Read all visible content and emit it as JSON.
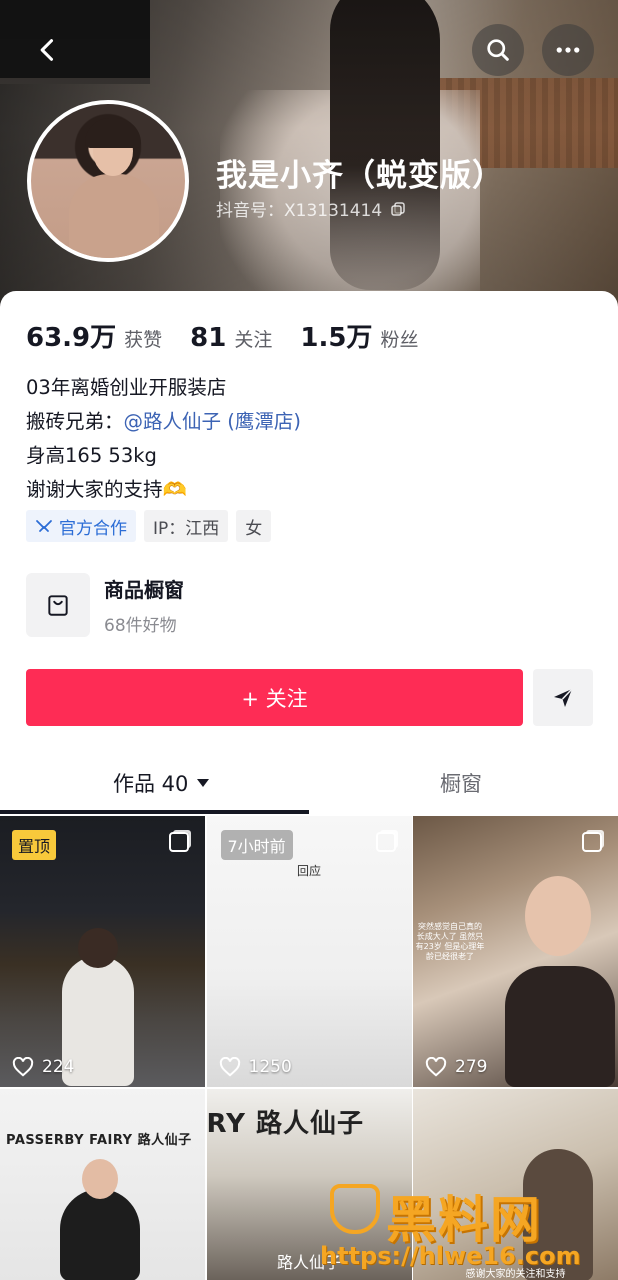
{
  "profile": {
    "nickname": "我是小齐（蜕变版）",
    "douyin_id": "抖音号：X13131414",
    "stats": [
      {
        "value": "63.9万",
        "label": "获赞"
      },
      {
        "value": "81",
        "label": "关注"
      },
      {
        "value": "1.5万",
        "label": "粉丝"
      }
    ],
    "bio": {
      "line1": "03年离婚创业开服装店",
      "line2_prefix": "搬砖兄弟：",
      "line2_mention": "@路人仙子 (鹰潭店)",
      "line3": "身高165 53kg",
      "line4": "谢谢大家的支持🫶"
    },
    "tags": [
      {
        "label": "官方合作",
        "icon": "handshake-icon"
      },
      {
        "label": "IP：江西"
      },
      {
        "label": "女"
      }
    ]
  },
  "shop": {
    "title": "商品橱窗",
    "subtitle": "68件好物"
  },
  "actions": {
    "follow_label": "+ 关注",
    "share_icon": "send-icon"
  },
  "tabs": {
    "works_label": "作品 40",
    "window_label": "橱窗"
  },
  "posts": [
    {
      "badge": "置顶",
      "likes": "224"
    },
    {
      "badge": "7小时前",
      "caption": "回应",
      "likes": "1250"
    },
    {
      "caption": "突然感觉自己真的长成大人了 虽然只有23岁 但是心理年龄已经很老了",
      "likes": "279"
    },
    {
      "sign": "PASSERBY FAIRY 路人仙子"
    },
    {
      "sign": "RY 路人仙子",
      "caption": "路人仙子"
    },
    {
      "caption": "感谢大家的关注和支持"
    }
  ],
  "watermark": {
    "text": "黑料网",
    "url": "https://hlwe16.com"
  },
  "colors": {
    "accent": "#fe2c55",
    "mention": "#3c63b4",
    "pin_badge": "#f8c93b",
    "official": "#2c6dd6"
  }
}
